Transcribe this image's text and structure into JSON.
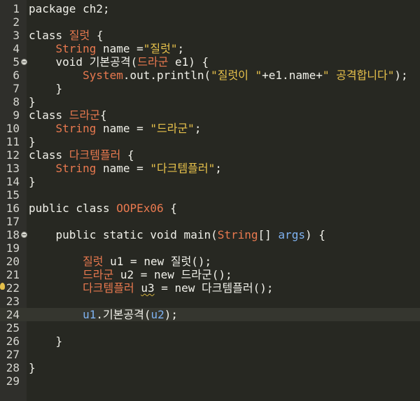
{
  "lines": [
    {
      "n": "1",
      "tokens": [
        {
          "t": "package ch2;",
          "c": "k"
        }
      ]
    },
    {
      "n": "2",
      "tokens": []
    },
    {
      "n": "3",
      "tokens": [
        {
          "t": "class ",
          "c": "k"
        },
        {
          "t": "질럿",
          "c": "t"
        },
        {
          "t": " {",
          "c": "p"
        }
      ]
    },
    {
      "n": "4",
      "tokens": [
        {
          "t": "    String",
          "c": "t"
        },
        {
          "t": " name =",
          "c": "k"
        },
        {
          "t": "\"질럿\"",
          "c": "s"
        },
        {
          "t": ";",
          "c": "p"
        }
      ]
    },
    {
      "n": "5",
      "tokens": [
        {
          "t": "    void ",
          "c": "k"
        },
        {
          "t": "기본공격(",
          "c": "k"
        },
        {
          "t": "드라군",
          "c": "t"
        },
        {
          "t": " e1) {",
          "c": "k"
        }
      ]
    },
    {
      "n": "6",
      "tokens": [
        {
          "t": "        System",
          "c": "t"
        },
        {
          "t": ".out.println(",
          "c": "k"
        },
        {
          "t": "\"질럿이 \"",
          "c": "s"
        },
        {
          "t": "+e1.name+",
          "c": "k"
        },
        {
          "t": "\" 공격합니다\"",
          "c": "s"
        },
        {
          "t": ");",
          "c": "p"
        }
      ]
    },
    {
      "n": "7",
      "tokens": [
        {
          "t": "    }",
          "c": "p"
        }
      ]
    },
    {
      "n": "8",
      "tokens": [
        {
          "t": "}",
          "c": "p"
        }
      ]
    },
    {
      "n": "9",
      "tokens": [
        {
          "t": "class ",
          "c": "k"
        },
        {
          "t": "드라군",
          "c": "t"
        },
        {
          "t": "{",
          "c": "p"
        }
      ]
    },
    {
      "n": "10",
      "tokens": [
        {
          "t": "    String",
          "c": "t"
        },
        {
          "t": " name = ",
          "c": "k"
        },
        {
          "t": "\"드라군\"",
          "c": "s"
        },
        {
          "t": ";",
          "c": "p"
        }
      ]
    },
    {
      "n": "11",
      "tokens": [
        {
          "t": "}",
          "c": "p"
        }
      ]
    },
    {
      "n": "12",
      "tokens": [
        {
          "t": "class ",
          "c": "k"
        },
        {
          "t": "다크템플러",
          "c": "t"
        },
        {
          "t": " {",
          "c": "p"
        }
      ]
    },
    {
      "n": "13",
      "tokens": [
        {
          "t": "    String",
          "c": "t"
        },
        {
          "t": " name = ",
          "c": "k"
        },
        {
          "t": "\"다크템플러\"",
          "c": "s"
        },
        {
          "t": ";",
          "c": "p"
        }
      ]
    },
    {
      "n": "14",
      "tokens": [
        {
          "t": "}",
          "c": "p"
        }
      ]
    },
    {
      "n": "15",
      "tokens": []
    },
    {
      "n": "16",
      "tokens": [
        {
          "t": "public class ",
          "c": "k"
        },
        {
          "t": "OOPEx06",
          "c": "t"
        },
        {
          "t": " {",
          "c": "p"
        }
      ]
    },
    {
      "n": "17",
      "tokens": []
    },
    {
      "n": "18",
      "tokens": [
        {
          "t": "    public static void main(",
          "c": "k"
        },
        {
          "t": "String",
          "c": "t"
        },
        {
          "t": "[] ",
          "c": "k"
        },
        {
          "t": "args",
          "c": "v"
        },
        {
          "t": ") {",
          "c": "p"
        }
      ]
    },
    {
      "n": "19",
      "tokens": []
    },
    {
      "n": "20",
      "tokens": [
        {
          "t": "        질럿",
          "c": "t"
        },
        {
          "t": " u1 = new ",
          "c": "k"
        },
        {
          "t": "질럿();",
          "c": "k"
        }
      ]
    },
    {
      "n": "21",
      "tokens": [
        {
          "t": "        드라군",
          "c": "t"
        },
        {
          "t": " u2 = new ",
          "c": "k"
        },
        {
          "t": "드라군();",
          "c": "k"
        }
      ]
    },
    {
      "n": "22",
      "tokens": [
        {
          "t": "        다크템플러",
          "c": "t"
        },
        {
          "t": " ",
          "c": "k"
        },
        {
          "t": "u3",
          "c": "k",
          "warn": true
        },
        {
          "t": " = new ",
          "c": "k"
        },
        {
          "t": "다크템플러();",
          "c": "k"
        }
      ]
    },
    {
      "n": "23",
      "tokens": []
    },
    {
      "n": "24",
      "tokens": [
        {
          "t": "        u1",
          "c": "v"
        },
        {
          "t": ".기본공격(",
          "c": "k"
        },
        {
          "t": "u2",
          "c": "v"
        },
        {
          "t": ");",
          "c": "p"
        }
      ]
    },
    {
      "n": "25",
      "tokens": []
    },
    {
      "n": "26",
      "tokens": [
        {
          "t": "    }",
          "c": "p"
        }
      ]
    },
    {
      "n": "27",
      "tokens": []
    },
    {
      "n": "28",
      "tokens": [
        {
          "t": "}",
          "c": "p"
        }
      ]
    },
    {
      "n": "29",
      "tokens": []
    }
  ],
  "current_line": "24",
  "fold_lines": [
    "5",
    "18"
  ],
  "warning_line": "22",
  "colors": {
    "background": "#272822",
    "keyword": "#f1f1ea",
    "type": "#e9794f",
    "string": "#e8c24b",
    "variable": "#7fb3f2"
  }
}
